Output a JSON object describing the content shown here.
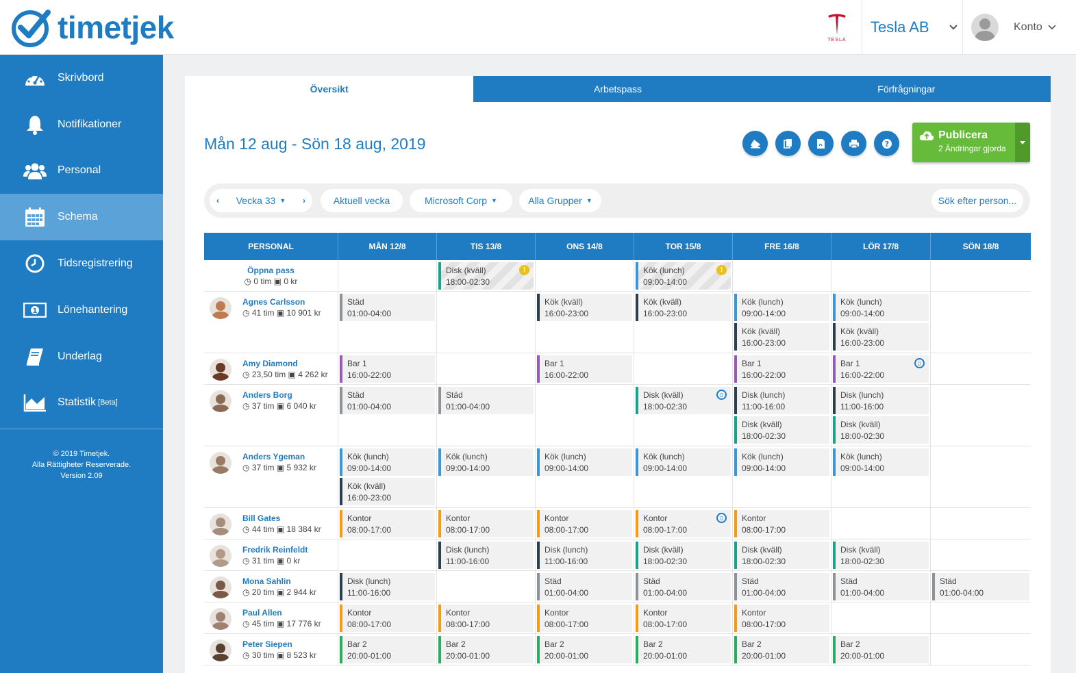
{
  "app": {
    "name": "timetjek"
  },
  "company": {
    "name": "Tesla AB",
    "logo_text": "TESLA"
  },
  "account": {
    "label": "Konto"
  },
  "colors": {
    "primary": "#1f7cc2",
    "publish": "#66bb3a",
    "warn": "#e8c11d"
  },
  "sidebar": {
    "items": [
      {
        "label": "Skrivbord",
        "icon": "dashboard-icon"
      },
      {
        "label": "Notifikationer",
        "icon": "bell-icon"
      },
      {
        "label": "Personal",
        "icon": "users-icon"
      },
      {
        "label": "Schema",
        "icon": "calendar-icon",
        "active": true
      },
      {
        "label": "Tidsregistrering",
        "icon": "clock-icon"
      },
      {
        "label": "Lönehantering",
        "icon": "money-icon"
      },
      {
        "label": "Underlag",
        "icon": "book-icon"
      },
      {
        "label": "Statistik",
        "sup": "[Beta]",
        "icon": "chart-icon"
      }
    ],
    "footer": {
      "line1": "© 2019 Timetjek.",
      "line2": "Alla Rättigheter Reserverade.",
      "line3": "Version 2.09"
    }
  },
  "tabs": [
    {
      "label": "Översikt",
      "active": true
    },
    {
      "label": "Arbetspass"
    },
    {
      "label": "Förfrågningar"
    }
  ],
  "header": {
    "title": "Mån 12 aug - Sön 18 aug, 2019"
  },
  "publish": {
    "title": "Publicera",
    "subtitle": "2 Ändringar gjorda"
  },
  "filters": {
    "week": "Vecka 33",
    "current_week": "Aktuell vecka",
    "client": "Microsoft Corp",
    "groups": "Alla Grupper",
    "search_placeholder": "Sök efter person..."
  },
  "grid": {
    "columns": [
      "PERSONAL",
      "MÅN 12/8",
      "TIS 13/8",
      "ONS 14/8",
      "TOR 15/8",
      "FRE 16/8",
      "LÖR 17/8",
      "SÖN 18/8"
    ],
    "open_shifts": {
      "name": "Öppna pass",
      "hours": "0 tim",
      "pay": "0 kr"
    },
    "rows": []
  }
}
